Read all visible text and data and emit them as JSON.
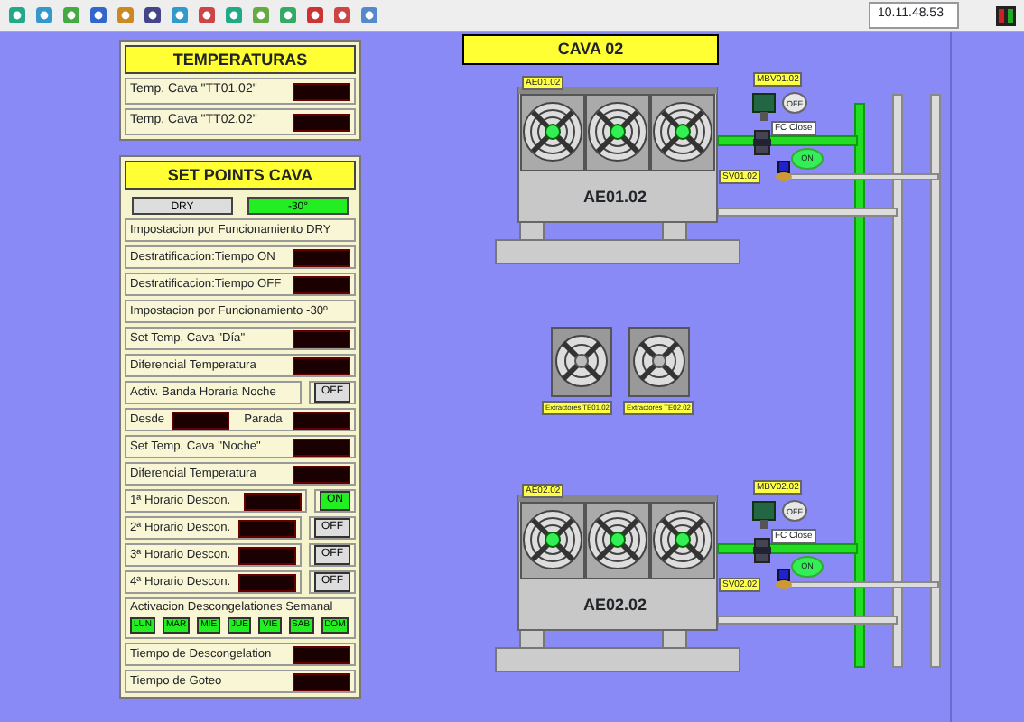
{
  "toolbar": {
    "clock": "10.11.48.53"
  },
  "temperatures": {
    "title": "TEMPERATURAS",
    "rows": [
      {
        "label": "Temp. Cava \"TT01.02\""
      },
      {
        "label": "Temp. Cava \"TT02.02\""
      }
    ]
  },
  "set_points": {
    "title": "SET POINTS CAVA",
    "modes": [
      {
        "label": "DRY",
        "selected": false
      },
      {
        "label": "-30°",
        "selected": true
      }
    ],
    "rows": [
      {
        "kind": "heading",
        "label": "Impostacion por Funcionamiento DRY"
      },
      {
        "kind": "display",
        "label": "Destratificacion:Tiempo ON"
      },
      {
        "kind": "display",
        "label": "Destratificacion:Tiempo OFF"
      },
      {
        "kind": "heading",
        "label": "Impostacion por Funcionamiento -30º"
      },
      {
        "kind": "display",
        "label": "Set Temp. Cava \"Día\""
      },
      {
        "kind": "display",
        "label": "Diferencial Temperatura"
      },
      {
        "kind": "toggle",
        "label": "Activ. Banda Horaria Noche",
        "button": "OFF",
        "on": false
      },
      {
        "kind": "range",
        "label": "Desde",
        "label_2": "Parada"
      },
      {
        "kind": "display",
        "label": "Set Temp. Cava \"Noche\""
      },
      {
        "kind": "display",
        "label": "Diferencial Temperatura"
      },
      {
        "kind": "schedule",
        "label": "1ª Horario Descon.",
        "button": "ON",
        "on": true
      },
      {
        "kind": "schedule",
        "label": "2ª Horario Descon.",
        "button": "OFF",
        "on": false
      },
      {
        "kind": "schedule",
        "label": "3ª Horario Descon.",
        "button": "OFF",
        "on": false
      },
      {
        "kind": "schedule",
        "label": "4ª Horario Descon.",
        "button": "OFF",
        "on": false
      },
      {
        "kind": "weekly",
        "label": "Activacion Descongelationes Semanal",
        "days": [
          {
            "label": "LUN",
            "on": true
          },
          {
            "label": "MAR",
            "on": true
          },
          {
            "label": "MIE",
            "on": true
          },
          {
            "label": "JUE",
            "on": true
          },
          {
            "label": "VIE",
            "on": true
          },
          {
            "label": "SAB",
            "on": true
          },
          {
            "label": "DOM",
            "on": true
          }
        ]
      },
      {
        "kind": "display",
        "label": "Tiempo de Descongelation"
      },
      {
        "kind": "display",
        "label": "Tiempo de Goteo"
      }
    ]
  },
  "cava": {
    "title": "CAVA 02",
    "units": [
      {
        "tag": "AE01.02",
        "name": "AE01.02",
        "running": true,
        "valve_tag": "MBV01.02",
        "valve_state": "OFF",
        "valve_on": false,
        "valve_position": "FC Close",
        "solenoid_tag": "SV01.02",
        "solenoid_state": "ON",
        "solenoid_on": true
      },
      {
        "tag": "AE02.02",
        "name": "AE02.02",
        "running": true,
        "valve_tag": "MBV02.02",
        "valve_state": "OFF",
        "valve_on": false,
        "valve_position": "FC Close",
        "solenoid_tag": "SV02.02",
        "solenoid_state": "ON",
        "solenoid_on": true
      }
    ],
    "extractors": [
      {
        "label": "Extractores TE01.02",
        "running": false
      },
      {
        "label": "Extractores TE02.02",
        "running": false
      }
    ]
  }
}
